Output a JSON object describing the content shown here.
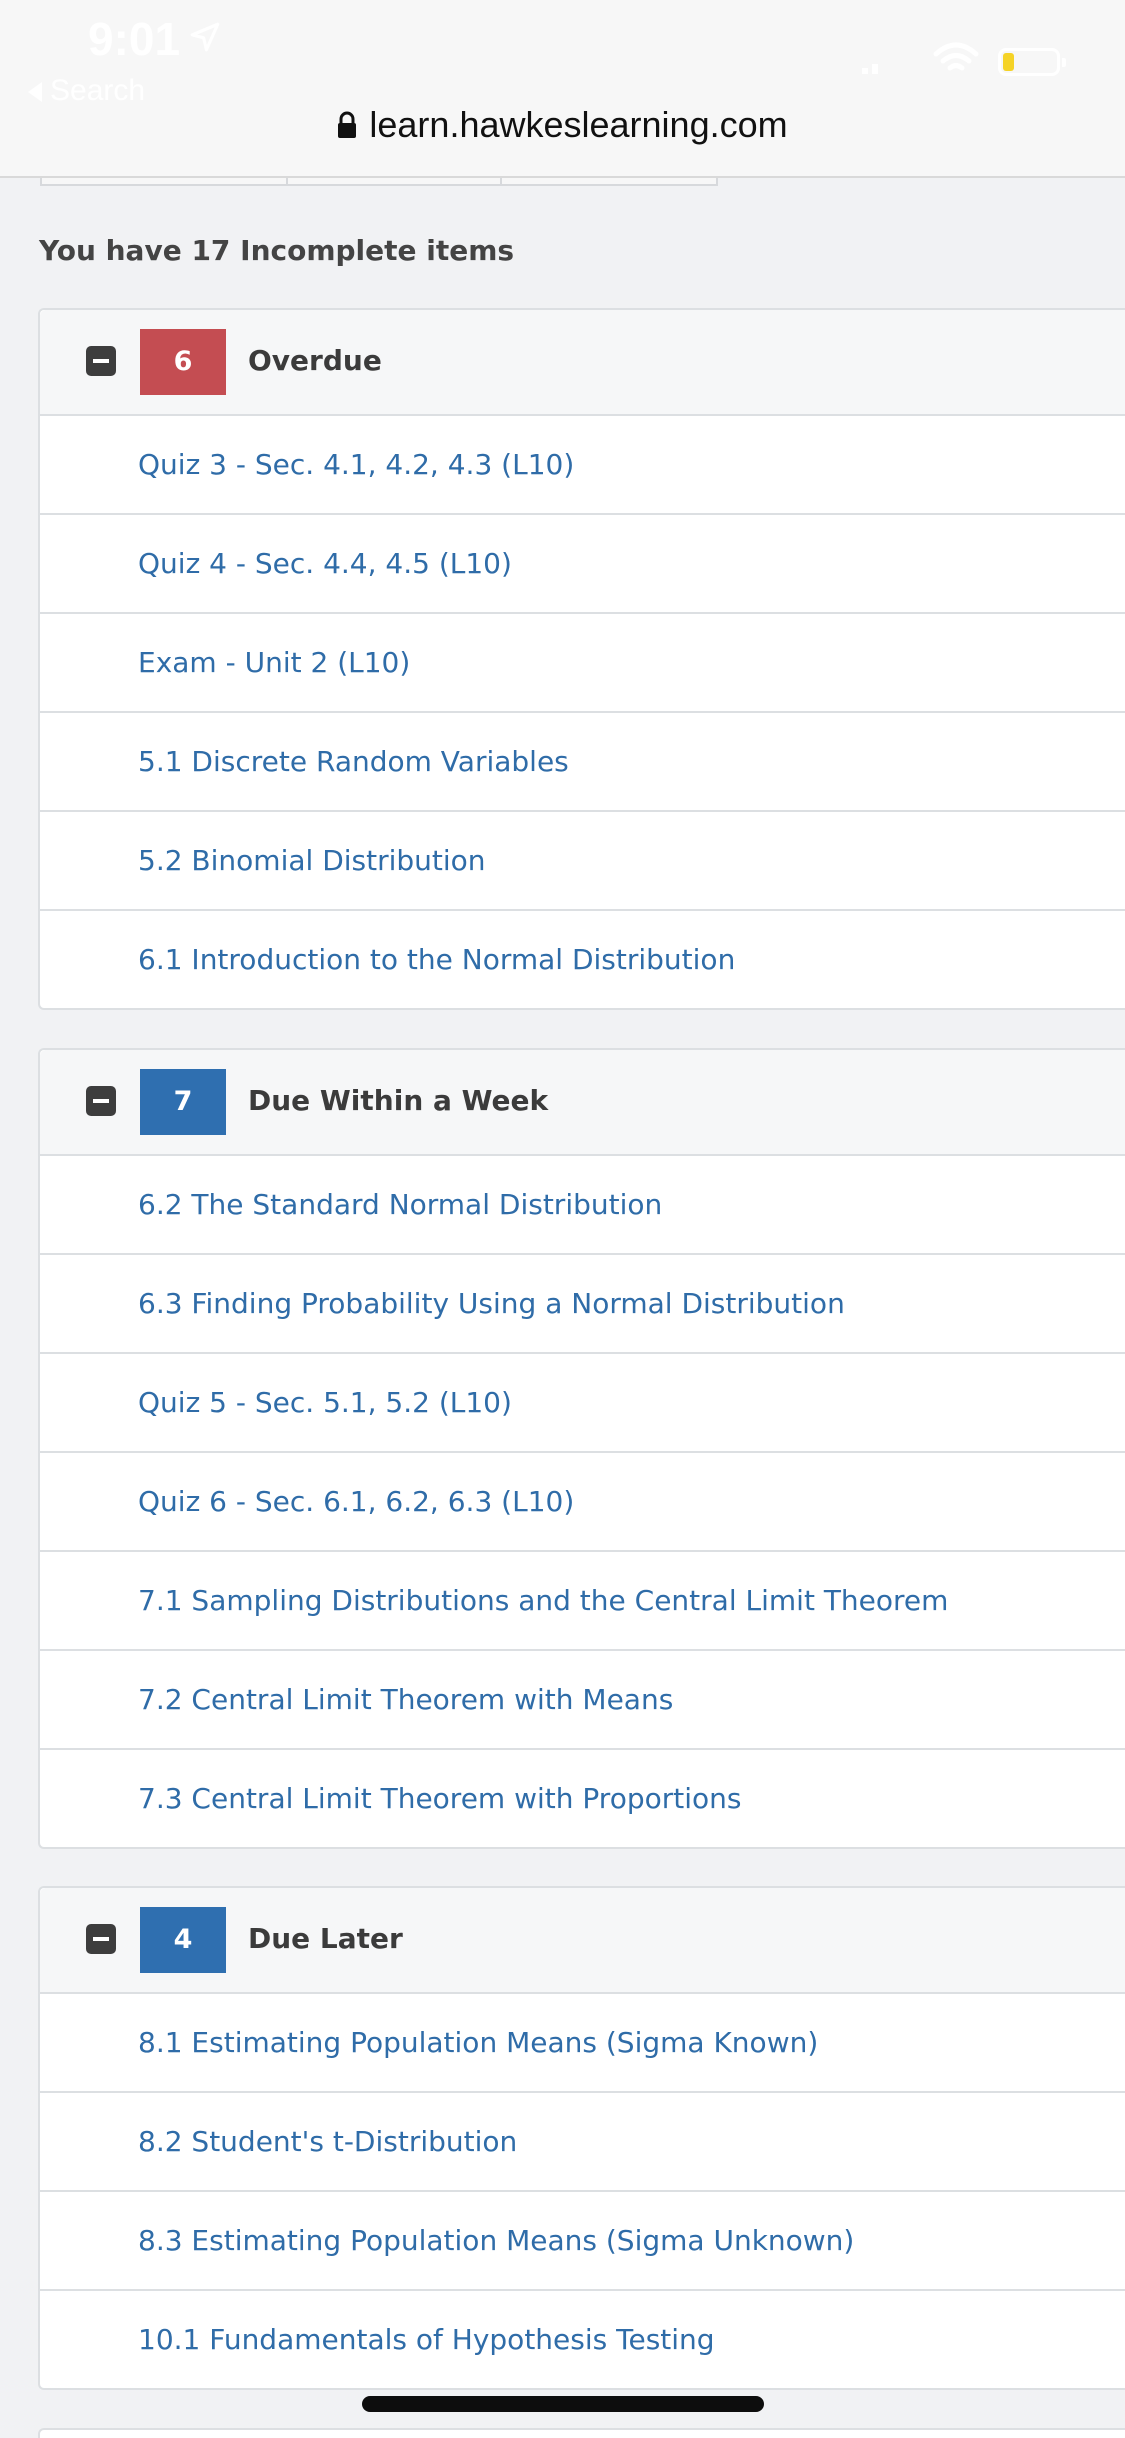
{
  "status_bar": {
    "time": "9:01",
    "back_label": "Search"
  },
  "browser": {
    "url": "learn.hawkeslearning.com"
  },
  "summary": {
    "heading": "You have 17 Incomplete items"
  },
  "colors": {
    "overdue_badge": "#c44d52",
    "upcoming_badge": "#2f6fb0",
    "link": "#2f6ca8",
    "battery_level": "#f5d327"
  },
  "groups": [
    {
      "count": "6",
      "title": "Overdue",
      "items": [
        "Quiz 3 - Sec. 4.1, 4.2, 4.3 (L10)",
        "Quiz 4 - Sec. 4.4, 4.5 (L10)",
        "Exam - Unit 2 (L10)",
        "5.1 Discrete Random Variables",
        "5.2 Binomial Distribution",
        "6.1 Introduction to the Normal Distribution"
      ]
    },
    {
      "count": "7",
      "title": "Due Within a Week",
      "items": [
        "6.2 The Standard Normal Distribution",
        "6.3 Finding Probability Using a Normal Distribution",
        "Quiz 5 - Sec. 5.1, 5.2 (L10)",
        "Quiz 6 - Sec. 6.1, 6.2, 6.3 (L10)",
        "7.1 Sampling Distributions and the Central Limit Theorem",
        "7.2 Central Limit Theorem with Means",
        "7.3 Central Limit Theorem with Proportions"
      ]
    },
    {
      "count": "4",
      "title": "Due Later",
      "items": [
        "8.1 Estimating Population Means (Sigma Known)",
        "8.2 Student's t-Distribution",
        "8.3 Estimating Population Means (Sigma Unknown)",
        "10.1 Fundamentals of Hypothesis Testing"
      ]
    }
  ]
}
